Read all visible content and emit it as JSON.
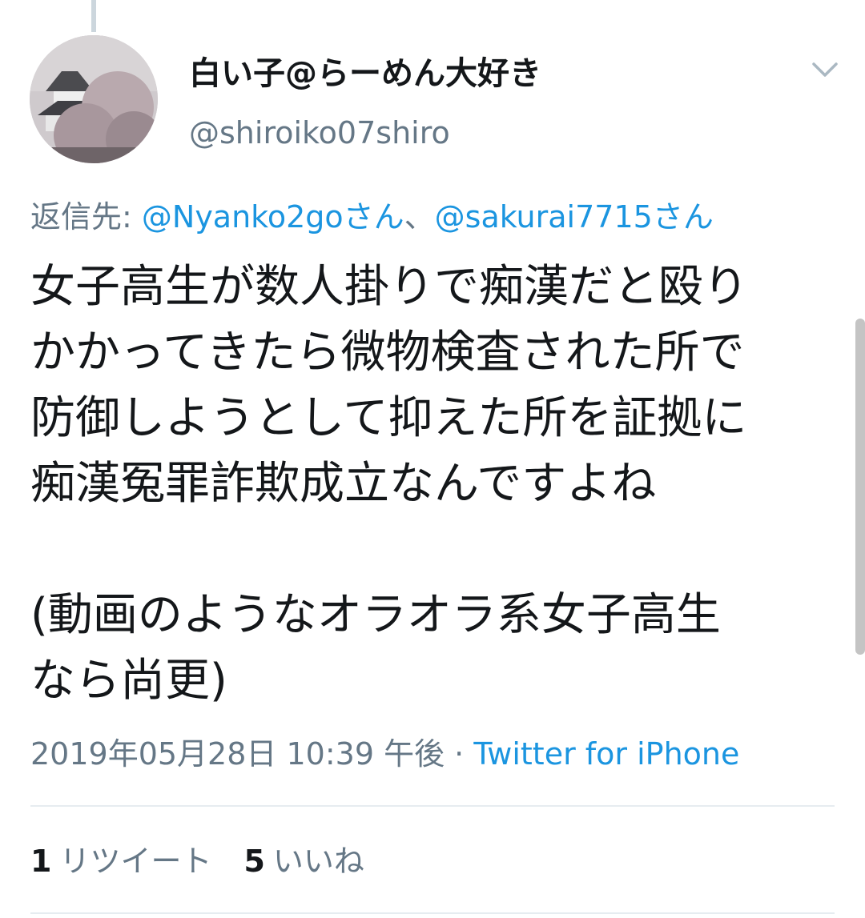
{
  "author": {
    "display_name": "白い子@らーめん大好き",
    "handle": "@shiroiko07shiro"
  },
  "reply": {
    "label": "返信先: ",
    "mention_1": "@Nyanko2goさん",
    "separator": "、",
    "mention_2": "@sakurai7715さん"
  },
  "tweet": {
    "lines": [
      "女子高生が数人掛りで痴漢だと殴り",
      "かかってきたら微物検査された所で",
      "防御しようとして抑えた所を証拠に",
      "痴漢冤罪詐欺成立なんですよね",
      "",
      "(動画のようなオラオラ系女子高生",
      "なら尚更)"
    ]
  },
  "meta": {
    "timestamp": "2019年05月28日 10:39 午後",
    "dot": " · ",
    "source": "Twitter for iPhone"
  },
  "stats": {
    "retweets_count": "1",
    "retweets_label": "リツイート",
    "likes_count": "5",
    "likes_label": "いいね"
  },
  "icons": {
    "menu": "chevron-down-icon",
    "avatar": "avatar-photo"
  },
  "colors": {
    "link": "#1b95e0",
    "secondary_text": "#657786",
    "primary_text": "#14171a"
  }
}
